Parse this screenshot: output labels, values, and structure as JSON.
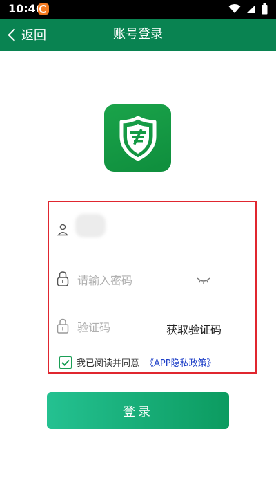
{
  "status_bar": {
    "time": "10:46"
  },
  "header": {
    "back_label": "返回",
    "title": "账号登录"
  },
  "form": {
    "password_placeholder": "请输入密码",
    "code_placeholder": "验证码",
    "get_code_label": "获取验证码",
    "agree_text": "我已阅读并同意",
    "policy_link": "《APP隐私政策》",
    "agree_checked": true
  },
  "login_button": {
    "label": "登录"
  },
  "colors": {
    "app_bar": "#098351",
    "logo_bg": "#1aa34a",
    "highlight_border": "#e0262f",
    "link": "#1d3fc8",
    "button_start": "#24c191",
    "button_end": "#0c9b60"
  },
  "icons": [
    "signal-icon",
    "wifi-icon",
    "battery-icon",
    "back-chevron-icon",
    "shield-logo-icon",
    "user-icon",
    "lock-icon",
    "eye-closed-icon",
    "lock-code-icon",
    "check-icon"
  ]
}
